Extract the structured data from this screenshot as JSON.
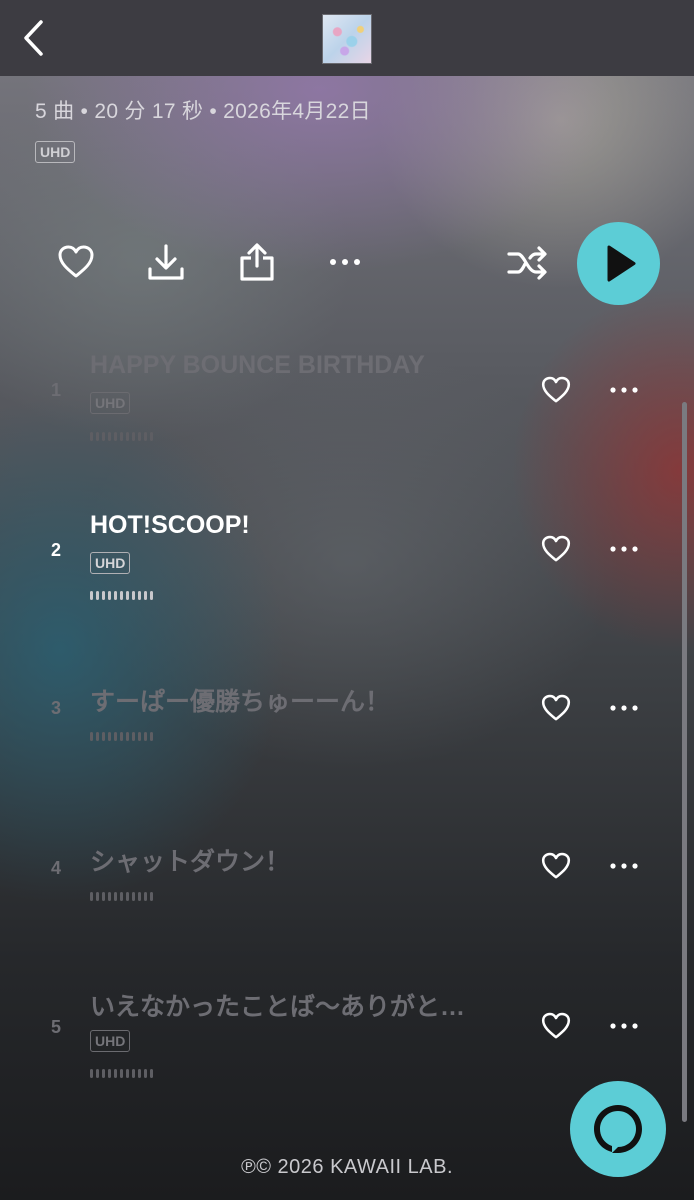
{
  "header": {
    "back_icon": "chevron-left-icon",
    "album_art": "album-cover-thumbnail"
  },
  "album": {
    "meta_text": "5 曲 • 20 分 17 秒 • 2026年4月22日",
    "quality_badge": "UHD"
  },
  "actions": {
    "icons": [
      "heart-icon",
      "download-icon",
      "share-icon",
      "more-horizontal-icon",
      "shuffle-icon",
      "play-icon"
    ],
    "accent_color": "#5ccdd6"
  },
  "tracks": [
    {
      "number": "1",
      "title": "HAPPY BOUNCE BIRTHDAY",
      "badge": "UHD",
      "state": "dim"
    },
    {
      "number": "2",
      "title": "HOT!SCOOP!",
      "badge": "UHD",
      "state": "active"
    },
    {
      "number": "3",
      "title": "すーぱー優勝ちゅーーん！",
      "badge": "",
      "state": "dim"
    },
    {
      "number": "4",
      "title": "シャットダウン！",
      "badge": "",
      "state": "dim"
    },
    {
      "number": "5",
      "title": "いえなかったことば〜ありがと…",
      "badge": "UHD",
      "state": "dim"
    }
  ],
  "footer": {
    "copyright": "℗© 2026 KAWAII LAB.",
    "assistant_icon": "alexa-ring-icon"
  }
}
